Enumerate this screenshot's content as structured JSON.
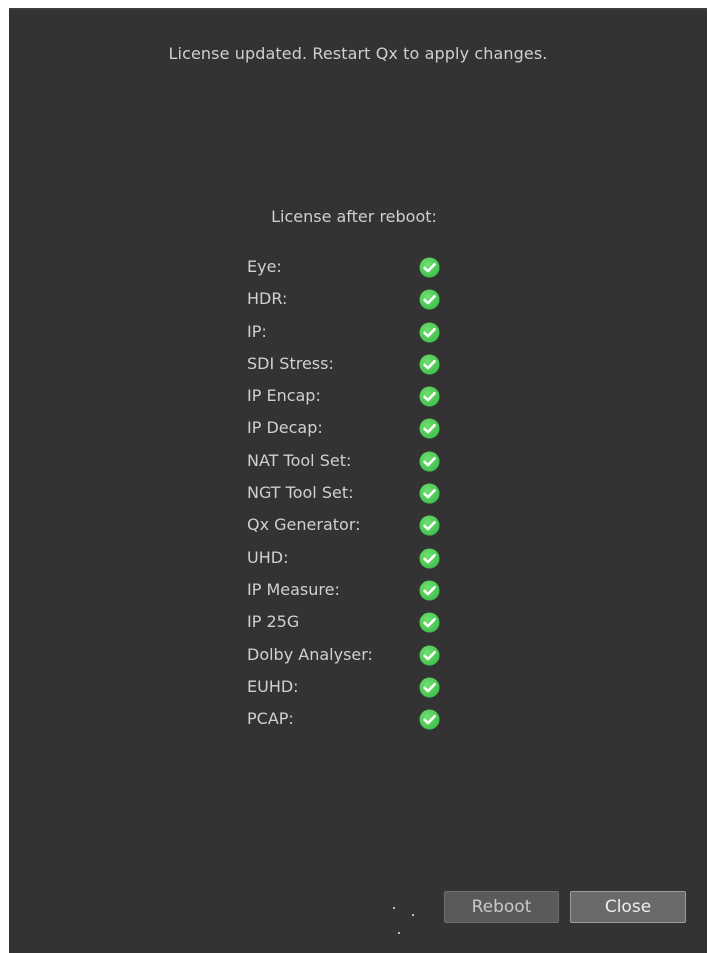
{
  "dialog": {
    "message": "License updated. Restart Qx to apply changes.",
    "subheading": "License after reboot:"
  },
  "features": [
    {
      "label": "Eye:",
      "enabled": true
    },
    {
      "label": "HDR:",
      "enabled": true
    },
    {
      "label": "IP:",
      "enabled": true
    },
    {
      "label": "SDI Stress:",
      "enabled": true
    },
    {
      "label": "IP Encap:",
      "enabled": true
    },
    {
      "label": "IP Decap:",
      "enabled": true
    },
    {
      "label": "NAT Tool Set:",
      "enabled": true
    },
    {
      "label": "NGT Tool Set:",
      "enabled": true
    },
    {
      "label": "Qx Generator:",
      "enabled": true
    },
    {
      "label": "UHD:",
      "enabled": true
    },
    {
      "label": "IP Measure:",
      "enabled": true
    },
    {
      "label": "IP 25G",
      "enabled": true
    },
    {
      "label": "Dolby Analyser:",
      "enabled": true
    },
    {
      "label": "EUHD:",
      "enabled": true
    },
    {
      "label": "PCAP:",
      "enabled": true
    }
  ],
  "icons": {
    "check": "check-circle-icon"
  },
  "colors": {
    "background": "#333333",
    "check_green": "#3fbf4a",
    "text": "#cfcfcf"
  },
  "buttons": {
    "reboot_label": "Reboot",
    "close_label": "Close"
  }
}
